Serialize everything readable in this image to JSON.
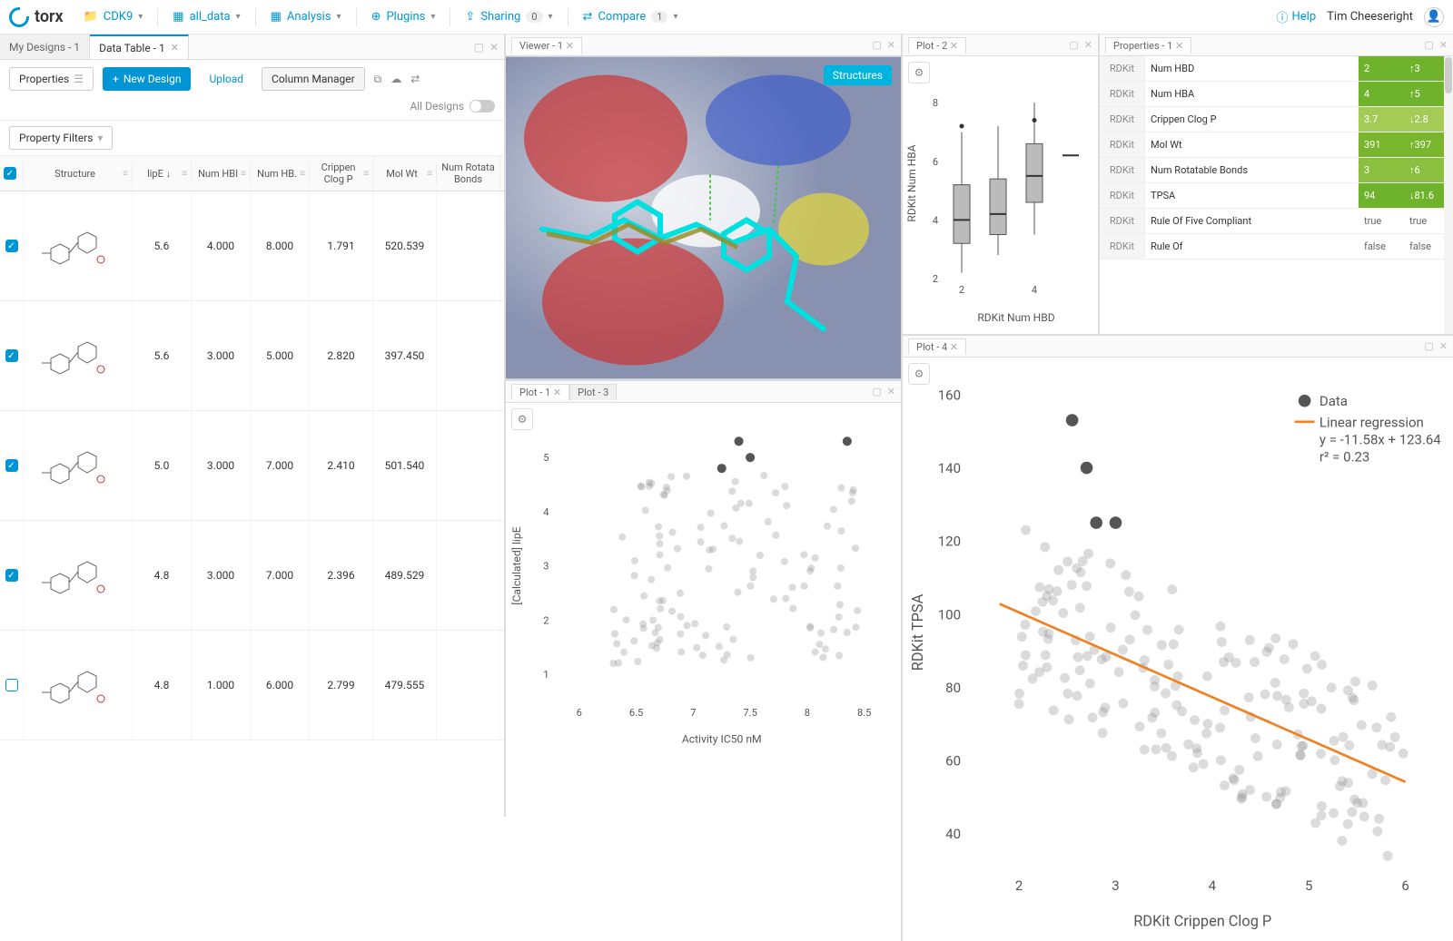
{
  "brand": "torx",
  "nav": {
    "project": "CDK9",
    "dataset": "all_data",
    "analysis": "Analysis",
    "plugins": "Plugins",
    "sharing": "Sharing",
    "sharing_count": "0",
    "compare": "Compare",
    "compare_count": "1"
  },
  "help": "Help",
  "user": "Tim Cheeseright",
  "left_tabs": [
    {
      "label": "My Designs - 1",
      "active": false
    },
    {
      "label": "Data Table - 1",
      "active": true
    }
  ],
  "dt_toolbar": {
    "properties": "Properties",
    "new_design": "New Design",
    "upload": "Upload",
    "column_manager": "Column Manager",
    "all_designs": "All Designs"
  },
  "property_filters": "Property Filters",
  "columns": [
    "",
    "Structure",
    "lipE",
    "Num HBI",
    "Num HB.",
    "Crippen Clog P",
    "Mol Wt",
    "Num Rotata Bonds"
  ],
  "rows": [
    {
      "checked": true,
      "lipE": "5.6",
      "hbd": "4.000",
      "hba": "8.000",
      "clogp": "1.791",
      "mw": "520.539"
    },
    {
      "checked": true,
      "lipE": "5.6",
      "hbd": "3.000",
      "hba": "5.000",
      "clogp": "2.820",
      "mw": "397.450"
    },
    {
      "checked": true,
      "lipE": "5.0",
      "hbd": "3.000",
      "hba": "7.000",
      "clogp": "2.410",
      "mw": "501.540"
    },
    {
      "checked": true,
      "lipE": "4.8",
      "hbd": "3.000",
      "hba": "7.000",
      "clogp": "2.396",
      "mw": "489.529"
    },
    {
      "checked": false,
      "lipE": "4.8",
      "hbd": "1.000",
      "hba": "6.000",
      "clogp": "2.799",
      "mw": "479.555"
    }
  ],
  "viewer_tab": "Viewer - 1",
  "viewer_button": "Structures",
  "plot2_tab": "Plot - 2",
  "plot1_tab": "Plot - 1",
  "plot3_tab": "Plot - 3",
  "plot4_tab": "Plot - 4",
  "properties_tab": "Properties - 1",
  "properties": [
    {
      "src": "RDKit",
      "name": "Num HBD",
      "v1": "2",
      "v2": "3",
      "dir": "up",
      "c": "green1"
    },
    {
      "src": "RDKit",
      "name": "Num HBA",
      "v1": "4",
      "v2": "5",
      "dir": "up",
      "c": "green1"
    },
    {
      "src": "RDKit",
      "name": "Crippen Clog P",
      "v1": "3.7",
      "v2": "2.8",
      "dir": "down",
      "c": "green3"
    },
    {
      "src": "RDKit",
      "name": "Mol Wt",
      "v1": "391",
      "v2": "397",
      "dir": "up",
      "c": "green4"
    },
    {
      "src": "RDKit",
      "name": "Num Rotatable Bonds",
      "v1": "3",
      "v2": "6",
      "dir": "up",
      "c": "green2"
    },
    {
      "src": "RDKit",
      "name": "TPSA",
      "v1": "94",
      "v2": "81.6",
      "dir": "down",
      "c": "green1"
    },
    {
      "src": "RDKit",
      "name": "Rule Of Five Compliant",
      "v1": "true",
      "v2": "true",
      "plain": true
    },
    {
      "src": "RDKit",
      "name": "Rule Of",
      "v1": "false",
      "v2": "false",
      "plain": true
    }
  ],
  "chart_data": [
    {
      "id": "plot2",
      "type": "box",
      "xlabel": "RDKit Num HBD",
      "ylabel": "RDKit Num HBA",
      "x_ticks": [
        2,
        4
      ],
      "y_ticks": [
        2,
        4,
        6,
        8
      ],
      "ylim": [
        2,
        8.5
      ],
      "series": [
        {
          "x": 2,
          "q1": 3.2,
          "median": 4.0,
          "q3": 5.2,
          "whisker_low": 2.2,
          "whisker_high": 7.0,
          "outliers": [
            7.2
          ]
        },
        {
          "x": 3,
          "q1": 3.5,
          "median": 4.2,
          "q3": 5.4,
          "whisker_low": 2.8,
          "whisker_high": 7.2,
          "outliers": []
        },
        {
          "x": 4,
          "q1": 4.6,
          "median": 5.5,
          "q3": 6.6,
          "whisker_low": 3.5,
          "whisker_high": 8.0,
          "outliers": [
            7.4
          ]
        },
        {
          "x": 5,
          "q1": 6.2,
          "median": 6.2,
          "q3": 6.2,
          "whisker_low": 6.2,
          "whisker_high": 6.2,
          "outliers": []
        }
      ]
    },
    {
      "id": "plot1",
      "type": "scatter",
      "xlabel": "Activity IC50 nM",
      "ylabel": "[Calculated] lipE",
      "x_ticks": [
        6,
        6.5,
        7,
        7.5,
        8,
        8.5
      ],
      "y_ticks": [
        1,
        2,
        3,
        4,
        5
      ],
      "xlim": [
        5.8,
        8.7
      ],
      "ylim": [
        0.5,
        5.5
      ],
      "highlight": [
        {
          "x": 7.25,
          "y": 4.8
        },
        {
          "x": 7.4,
          "y": 5.3
        },
        {
          "x": 7.5,
          "y": 5.0
        },
        {
          "x": 8.35,
          "y": 5.3
        }
      ],
      "points_approx_count": 120
    },
    {
      "id": "plot4",
      "type": "scatter",
      "xlabel": "RDKit Crippen Clog P",
      "ylabel": "RDKit TPSA",
      "x_ticks": [
        2,
        3,
        4,
        5,
        6
      ],
      "y_ticks": [
        40,
        60,
        80,
        100,
        120,
        140,
        160
      ],
      "xlim": [
        1.5,
        6.3
      ],
      "ylim": [
        30,
        160
      ],
      "legend": [
        "Data",
        "Linear regression"
      ],
      "regression": {
        "label": "y = -11.58x + 123.64",
        "r2": "r² = 0.23",
        "slope": -11.58,
        "intercept": 123.64
      },
      "highlight": [
        {
          "x": 2.55,
          "y": 153
        },
        {
          "x": 2.7,
          "y": 140
        },
        {
          "x": 2.8,
          "y": 125
        },
        {
          "x": 3.0,
          "y": 125
        }
      ],
      "points_approx_count": 180
    }
  ]
}
